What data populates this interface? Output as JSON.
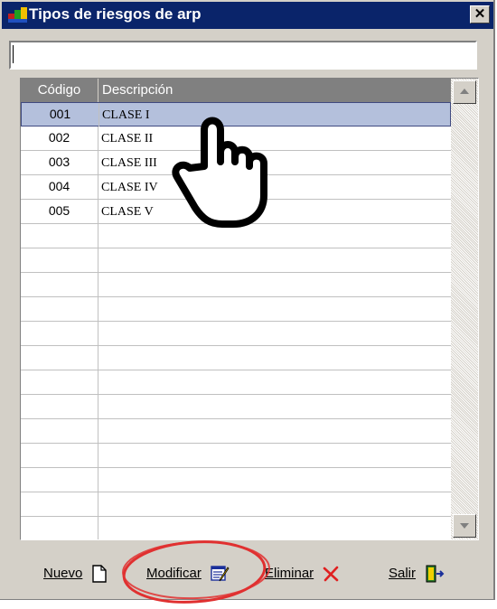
{
  "window": {
    "title": "Tipos de riesgos de arp",
    "close_label": "✕"
  },
  "filter": {
    "value": "",
    "placeholder": ""
  },
  "grid": {
    "columns": [
      "Código",
      "Descripción"
    ],
    "rows": [
      {
        "codigo": "001",
        "descripcion": "CLASE I",
        "selected": true
      },
      {
        "codigo": "002",
        "descripcion": "CLASE II"
      },
      {
        "codigo": "003",
        "descripcion": "CLASE III"
      },
      {
        "codigo": "004",
        "descripcion": "CLASE IV"
      },
      {
        "codigo": "005",
        "descripcion": "CLASE V"
      }
    ],
    "empty_rows": 13
  },
  "toolbar": {
    "nuevo_label": "Nuevo",
    "modificar_label": "Modificar",
    "eliminar_label": "Eliminar",
    "salir_label": "Salir"
  },
  "icons": {
    "app": "app-icon",
    "new": "new-document-icon",
    "edit": "edit-icon",
    "delete": "delete-x-icon",
    "exit": "exit-door-icon"
  },
  "colors": {
    "titlebar": "#0a246a",
    "selection": "#b4c0dc",
    "header": "#808080",
    "highlight": "#e03030",
    "delete": "#e02020"
  }
}
